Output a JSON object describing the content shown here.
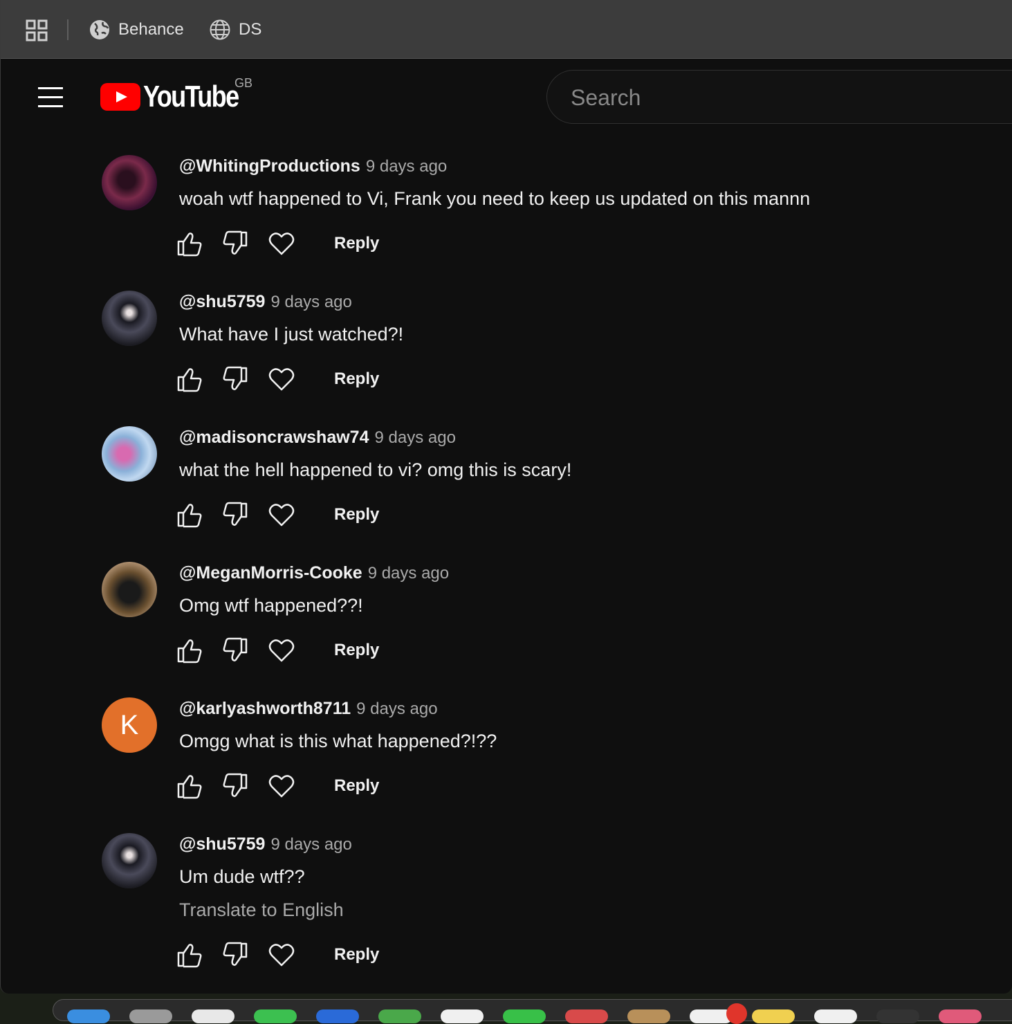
{
  "bookmarks": {
    "items": [
      {
        "label": "Behance",
        "icon": "globe-filled-icon"
      },
      {
        "label": "DS",
        "icon": "globe-outline-icon"
      }
    ]
  },
  "header": {
    "logo_text": "YouTube",
    "region": "GB",
    "search_placeholder": "Search"
  },
  "comments": [
    {
      "author": "@WhitingProductions",
      "time": "9 days ago",
      "text": "woah wtf happened to Vi, Frank you need to keep us updated on this mannn",
      "reply": "Reply",
      "avatar_color": "#6b1f3a"
    },
    {
      "author": "@shu5759",
      "time": "9 days ago",
      "text": "What have I just watched?!",
      "reply": "Reply",
      "avatar_color": "#2a2a33"
    },
    {
      "author": "@madisoncrawshaw74",
      "time": "9 days ago",
      "text": "what the hell happened to vi? omg this is scary!",
      "reply": "Reply",
      "avatar_color": "#6fa0c8"
    },
    {
      "author": "@MeganMorris-Cooke",
      "time": "9 days ago",
      "text": "Omg wtf happened??!",
      "reply": "Reply",
      "avatar_color": "#8a6a4a"
    },
    {
      "author": "@karlyashworth8711",
      "time": "9 days ago",
      "text": "Omgg what is this what happened?!??",
      "reply": "Reply",
      "avatar_letter": "K",
      "avatar_color": "#e2702a"
    },
    {
      "author": "@shu5759",
      "time": "9 days ago",
      "text": "Um dude wtf??",
      "translate": "Translate to English",
      "reply": "Reply",
      "avatar_color": "#2a2a33"
    }
  ]
}
